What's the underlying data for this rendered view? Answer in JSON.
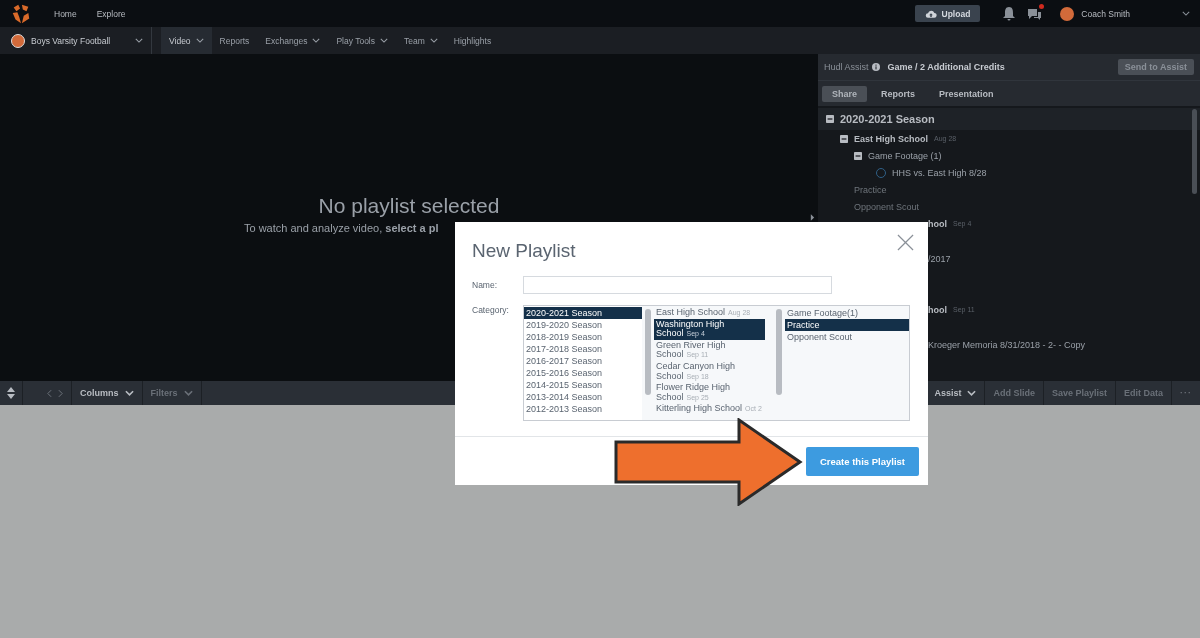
{
  "top_bar": {
    "nav": [
      {
        "label": "Home"
      },
      {
        "label": "Explore"
      }
    ],
    "upload": "Upload",
    "messages_unread": true,
    "user": "Coach Smith"
  },
  "team_bar": {
    "team": "Boys Varsity Football",
    "tabs": [
      {
        "label": "Video",
        "selected": true,
        "dropdown": true
      },
      {
        "label": "Reports",
        "selected": false,
        "dropdown": false
      },
      {
        "label": "Exchanges",
        "selected": false,
        "dropdown": true
      },
      {
        "label": "Play Tools",
        "selected": false,
        "dropdown": true
      },
      {
        "label": "Team",
        "selected": false,
        "dropdown": true
      },
      {
        "label": "Highlights",
        "selected": false,
        "dropdown": false
      }
    ]
  },
  "stage": {
    "title": "No playlist selected",
    "subtitle": "To watch and analyze video, **select a pl**"
  },
  "assist": {
    "label": "Hudl Assist",
    "credits": "Game / 2 Additional Credits",
    "button": "Send to Assist",
    "tabs": [
      {
        "label": "Share",
        "selected": true
      },
      {
        "label": "Reports",
        "selected": false
      },
      {
        "label": "Presentation",
        "selected": false
      }
    ]
  },
  "tree": [
    {
      "label": "2020-2021 Season",
      "kind": "season",
      "expanded": true,
      "children": [
        {
          "label": "East High School",
          "date": "Aug 28",
          "kind": "school",
          "expanded": true,
          "children": [
            {
              "label": "Game Footage (1)",
              "kind": "category",
              "expanded": true,
              "children": [
                {
                  "label": "HHS vs. East High 8/28",
                  "kind": "video",
                  "selected": false
                }
              ]
            },
            {
              "label": "Practice",
              "kind": "empty"
            },
            {
              "label": "Opponent Scout",
              "kind": "empty"
            }
          ]
        },
        {
          "label": "hool",
          "date": "Sep 4",
          "kind": "clipped-school",
          "children": [
            {
              "label": "/2017",
              "kind": "clipped"
            }
          ]
        },
        {
          "label": "hool",
          "date": "Sep 11",
          "kind": "clipped-school",
          "children": [
            {
              "label": "Kroeger Memoria 8/31/2018 - 2- - Copy",
              "kind": "clipped"
            }
          ]
        }
      ]
    }
  ],
  "toolbar": {
    "left": [
      {
        "label": "Columns",
        "disabled": false
      },
      {
        "label": "Filters",
        "disabled": true
      }
    ],
    "right": [
      {
        "label": "Assist",
        "kind": "dropdown",
        "disabled": false
      },
      {
        "label": "Add Slide",
        "kind": "action",
        "disabled": true
      },
      {
        "label": "Save Playlist",
        "kind": "action",
        "disabled": true
      },
      {
        "label": "Edit Data",
        "kind": "action",
        "disabled": true
      },
      {
        "label": "···",
        "kind": "more",
        "disabled": true
      }
    ]
  },
  "dialog": {
    "title": "New Playlist",
    "name_label": "Name:",
    "category_label": "Category:",
    "lists": [
      [
        {
          "label": "2020-2021 Season",
          "selected": true
        },
        {
          "label": "2019-2020 Season",
          "selected": false
        },
        {
          "label": "2018-2019 Season",
          "selected": false
        },
        {
          "label": "2017-2018 Season",
          "selected": false
        },
        {
          "label": "2016-2017 Season",
          "selected": false
        },
        {
          "label": "2015-2016 Season",
          "selected": false
        },
        {
          "label": "2014-2015 Season",
          "selected": false
        },
        {
          "label": "2013-2014 Season",
          "selected": false
        },
        {
          "label": "2012-2013 Season",
          "selected": false
        }
      ],
      [
        {
          "label": "East High School",
          "date": "Aug 28",
          "selected": false
        },
        {
          "label": "Washington High School",
          "date": "Sep 4",
          "selected": true
        },
        {
          "label": "Green River High School",
          "date": "Sep 11",
          "selected": false
        },
        {
          "label": "Cedar Canyon High School",
          "date": "Sep 18",
          "selected": false
        },
        {
          "label": "Flower Ridge High School",
          "date": "Sep 25",
          "selected": false
        },
        {
          "label": "Kitterling High School",
          "date": "Oct 2",
          "selected": false
        }
      ],
      [
        {
          "label": "Game Footage(1)",
          "selected": false
        },
        {
          "label": "Practice",
          "selected": true
        },
        {
          "label": "Opponent Scout",
          "selected": false
        }
      ]
    ],
    "button": "Create this Playlist"
  }
}
